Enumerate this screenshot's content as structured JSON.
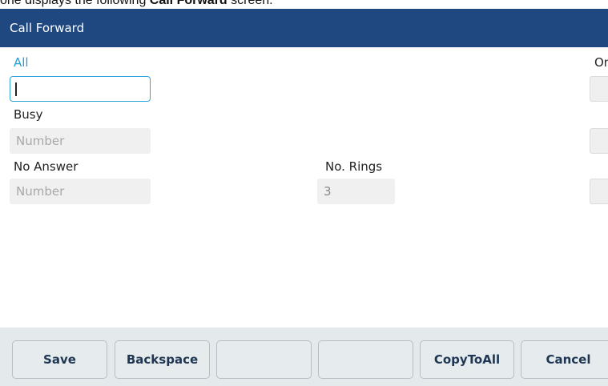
{
  "caption": {
    "prefix": "one displays the following ",
    "bold": "Call Forward",
    "suffix": " screen."
  },
  "header": {
    "title": "Call Forward"
  },
  "form": {
    "all_label": "All",
    "all_value": "",
    "busy_label": "Busy",
    "busy_placeholder": "Number",
    "noanswer_label": "No Answer",
    "noanswer_placeholder": "Number",
    "rings_label": "No. Rings",
    "rings_value": "3",
    "right_label_partial": "On"
  },
  "softkeys": {
    "save": "Save",
    "backspace": "Backspace",
    "blank1": "",
    "blank2": "",
    "copytoall": "CopyToAll",
    "cancel": "Cancel"
  },
  "colors": {
    "header_bg": "#1f4880",
    "active_label": "#1ea0d8",
    "softkey_text": "#1e3652"
  }
}
